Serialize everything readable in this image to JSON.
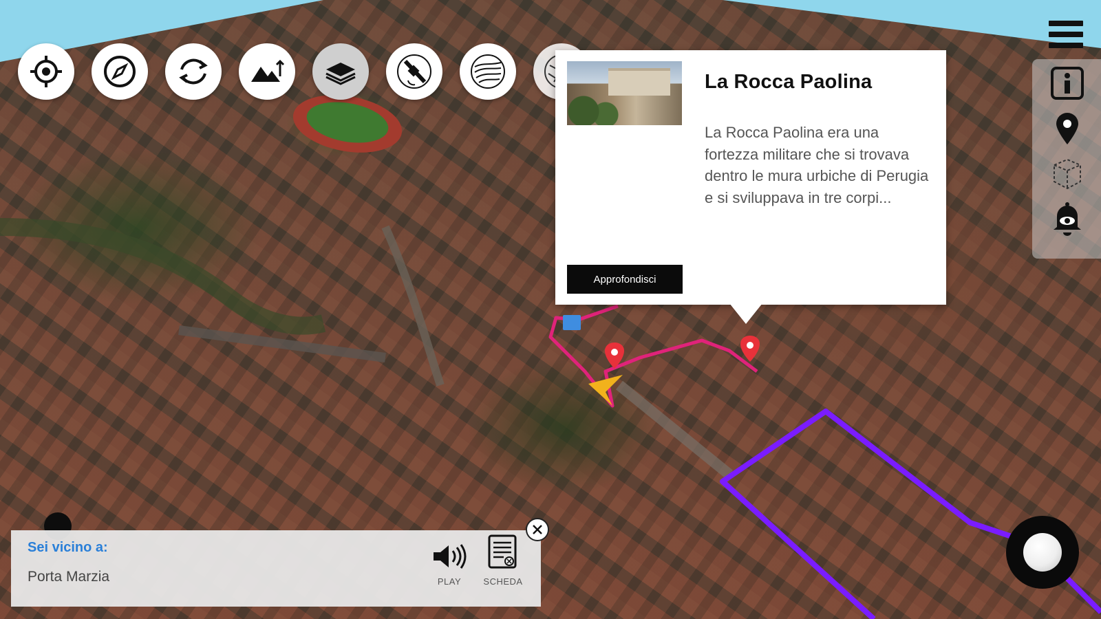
{
  "toolbar": {
    "buttons": [
      {
        "name": "my-location",
        "icon": "crosshair-icon"
      },
      {
        "name": "compass",
        "icon": "compass-icon"
      },
      {
        "name": "rotate",
        "icon": "rotate-icon"
      },
      {
        "name": "terrain",
        "icon": "mountains-icon"
      },
      {
        "name": "layers",
        "icon": "layers-icon",
        "state": "active"
      },
      {
        "name": "satellite",
        "icon": "satellite-icon"
      },
      {
        "name": "topographic",
        "icon": "contour-icon"
      },
      {
        "name": "street-map",
        "icon": "map-icon"
      }
    ]
  },
  "right_rail": {
    "icons": [
      "menu-icon",
      "info-icon",
      "map-pin-icon",
      "3d-cube-icon",
      "eye-bell-icon"
    ]
  },
  "popup": {
    "title": "La Rocca Paolina",
    "description": "La Rocca Paolina era una fortezza militare che si trovava dentro le mura urbiche di Perugia e si sviluppava in tre corpi...",
    "button_label": "Approfondisci"
  },
  "nearby": {
    "heading": "Sei vicino a:",
    "place": "Porta Marzia",
    "play_label": "PLAY",
    "sheet_label": "SCHEDA"
  },
  "colors": {
    "accent_blue": "#2a7fd8",
    "route_pink": "#e0237a",
    "route_purple": "#7a1cff",
    "pin_red": "#e8313a"
  }
}
